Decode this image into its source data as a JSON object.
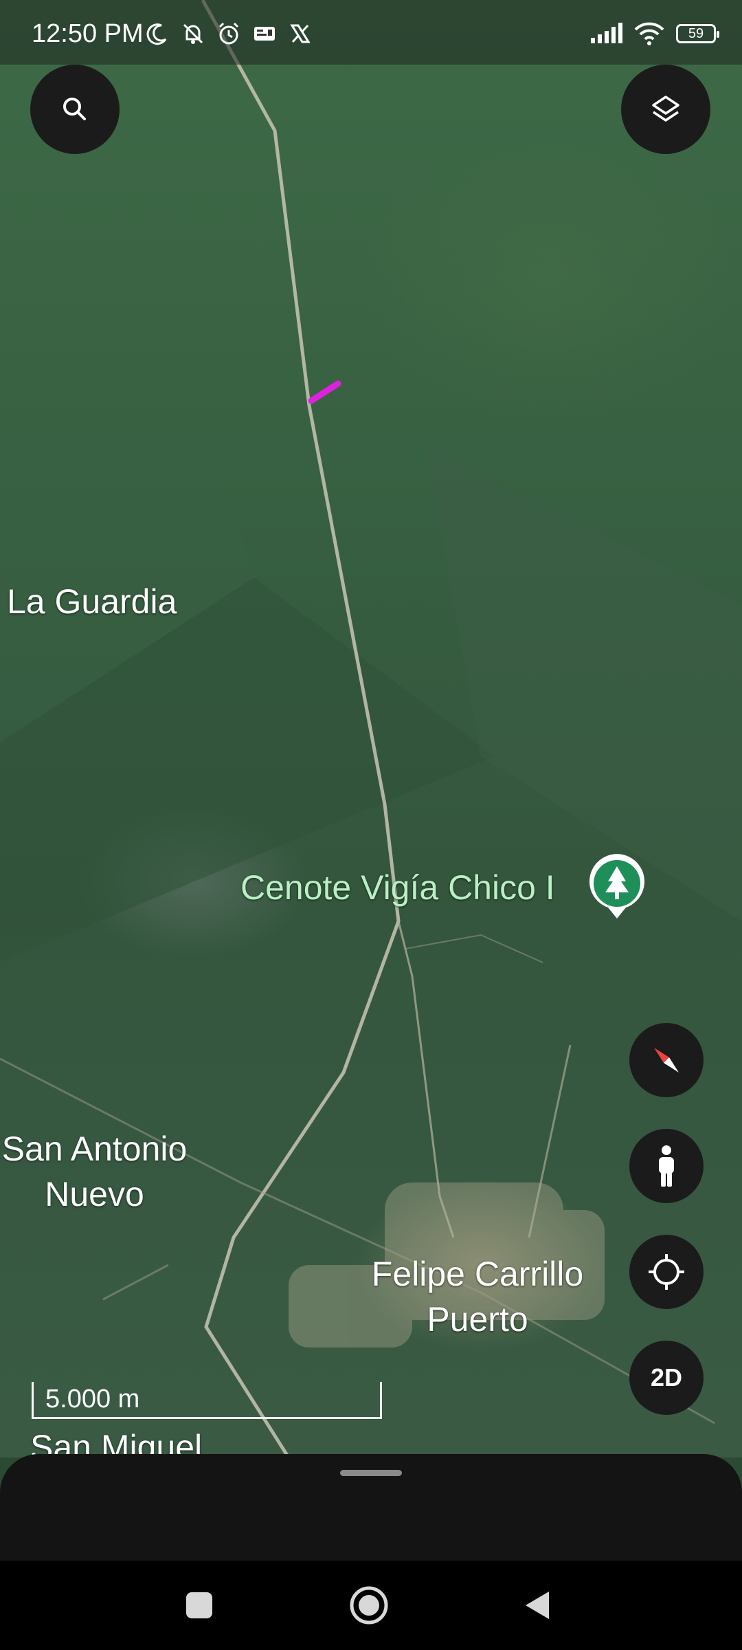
{
  "status_bar": {
    "time": "12:50 PM",
    "battery": "59",
    "icons_left": [
      "moon-icon",
      "bell-off-icon",
      "alarm-icon",
      "id-card-icon",
      "x-logo-icon"
    ],
    "icons_right": [
      "signal-icon",
      "wifi-icon",
      "battery-icon"
    ]
  },
  "map": {
    "places": [
      {
        "name": "La Guardia"
      },
      {
        "name": "San Antonio\nNuevo"
      },
      {
        "name": "Felipe Carrillo\nPuerto"
      },
      {
        "name": "San Miguel"
      }
    ],
    "poi": {
      "name": "Cenote Vigía Chico I",
      "icon": "tree-icon",
      "color": "#1f8f5a"
    },
    "scale": "5.000 m",
    "measure_line_color": "#e020e0"
  },
  "controls": {
    "search": "search-icon",
    "layers": "layers-icon",
    "compass": "compass-icon",
    "street_view": "pegman-icon",
    "my_location": "location-icon",
    "view_mode": "2D"
  },
  "nav": [
    "recents-icon",
    "home-icon",
    "back-icon"
  ]
}
